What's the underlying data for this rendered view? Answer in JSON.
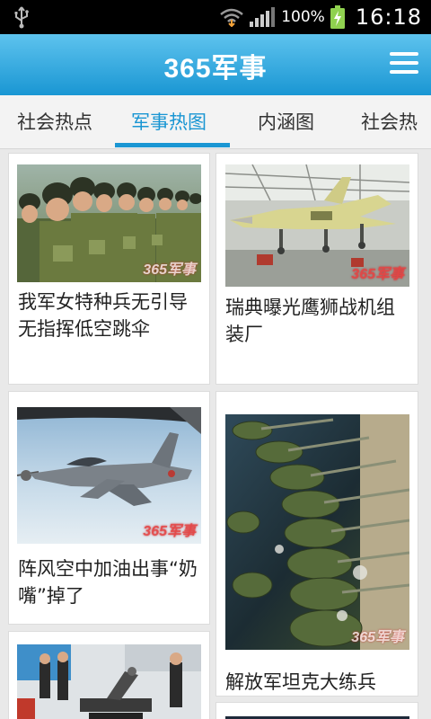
{
  "status_bar": {
    "battery_percent": "100%",
    "time": "16:18"
  },
  "header": {
    "title": "365军事"
  },
  "tabs": [
    {
      "label": "社会热点",
      "active": false
    },
    {
      "label": "军事热图",
      "active": true
    },
    {
      "label": "内涵图",
      "active": false
    },
    {
      "label": "社会热",
      "active": false
    }
  ],
  "cards": [
    {
      "title": "我军女特种兵无引导无指挥低空跳伞",
      "watermark": "365军事"
    },
    {
      "title": "瑞典曝光鹰狮战机组装厂",
      "watermark": "365军事"
    },
    {
      "title": "阵风空中加油出事“奶嘴”掉了",
      "watermark": "365军事"
    },
    {
      "title": "解放军坦克大练兵",
      "watermark": "365军事"
    },
    {
      "title": "",
      "watermark": ""
    }
  ],
  "colors": {
    "accent": "#1a96d3",
    "header_top": "#5ec3ee",
    "background": "#e9e9e9"
  }
}
